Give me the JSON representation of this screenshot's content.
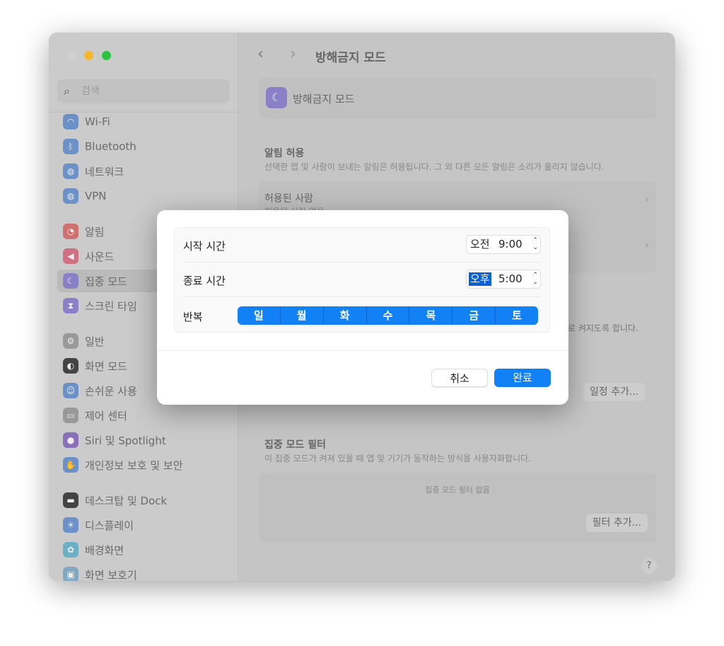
{
  "window": {
    "title": "방해금지 모드",
    "traffic_colors": [
      "#d0d0d0",
      "#f5b72a",
      "#2bc33f"
    ]
  },
  "sidebar": {
    "search_placeholder": "검색",
    "items": [
      {
        "label": "Wi-Fi",
        "icon": "wifi-icon",
        "color": "#6c90c8"
      },
      {
        "label": "Bluetooth",
        "icon": "bluetooth-icon",
        "color": "#6c90c8"
      },
      {
        "label": "네트워크",
        "icon": "globe-icon",
        "color": "#6c90c8"
      },
      {
        "label": "VPN",
        "icon": "vpn-globe-icon",
        "color": "#6c90c8"
      },
      {
        "label": "알림",
        "icon": "bell-icon",
        "color": "#d07070"
      },
      {
        "label": "사운드",
        "icon": "speaker-icon",
        "color": "#d07080"
      },
      {
        "label": "집중 모드",
        "icon": "moon-icon",
        "color": "#8a80c8",
        "selected": true
      },
      {
        "label": "스크린 타임",
        "icon": "hourglass-icon",
        "color": "#8a80c8"
      },
      {
        "label": "일반",
        "icon": "gear-icon",
        "color": "#999999"
      },
      {
        "label": "화면 모드",
        "icon": "appearance-icon",
        "color": "#444444"
      },
      {
        "label": "손쉬운 사용",
        "icon": "accessibility-icon",
        "color": "#6c90c8"
      },
      {
        "label": "제어 센터",
        "icon": "toggles-icon",
        "color": "#999999"
      },
      {
        "label": "Siri 및 Spotlight",
        "icon": "siri-icon",
        "color": "#8a70b8"
      },
      {
        "label": "개인정보 보호 및 보안",
        "icon": "hand-icon",
        "color": "#6c90c8"
      },
      {
        "label": "데스크탑 및 Dock",
        "icon": "dock-icon",
        "color": "#444444"
      },
      {
        "label": "디스플레이",
        "icon": "sun-icon",
        "color": "#6c90c8"
      },
      {
        "label": "배경화면",
        "icon": "flower-icon",
        "color": "#6cb0c8"
      },
      {
        "label": "화면 보호기",
        "icon": "screensaver-icon",
        "color": "#80a8c0"
      }
    ]
  },
  "main": {
    "header": "방해금지 모드",
    "allow": {
      "title": "알림 허용",
      "desc": "선택한 앱 및 사람이 보내는 알림은 허용됩니다. 그 외 다른 모든 알림은 소리가 울리지 않습니다."
    },
    "people": {
      "title": "허용된 사람",
      "sub": "허용된 사람 없음"
    },
    "partial_text": "로 켜지도록 합니다.",
    "add_schedule": "일정 추가...",
    "filter": {
      "title": "집중 모드 필터",
      "desc": "이 집중 모드가 켜져 있을 때 앱 및 기기가 동작하는 방식을 사용자화합니다.",
      "empty": "집중 모드 필터 없음",
      "add": "필터 추가..."
    },
    "help": "?"
  },
  "dialog": {
    "start": {
      "label": "시작 시간",
      "ampm": "오전",
      "time": "9:00"
    },
    "end": {
      "label": "종료 시간",
      "ampm": "오후",
      "time": "5:00"
    },
    "repeat": {
      "label": "반복",
      "days": [
        "일",
        "월",
        "화",
        "수",
        "목",
        "금",
        "토"
      ],
      "selected": [
        true,
        true,
        true,
        true,
        true,
        true,
        true
      ]
    },
    "cancel": "취소",
    "done": "완료"
  }
}
